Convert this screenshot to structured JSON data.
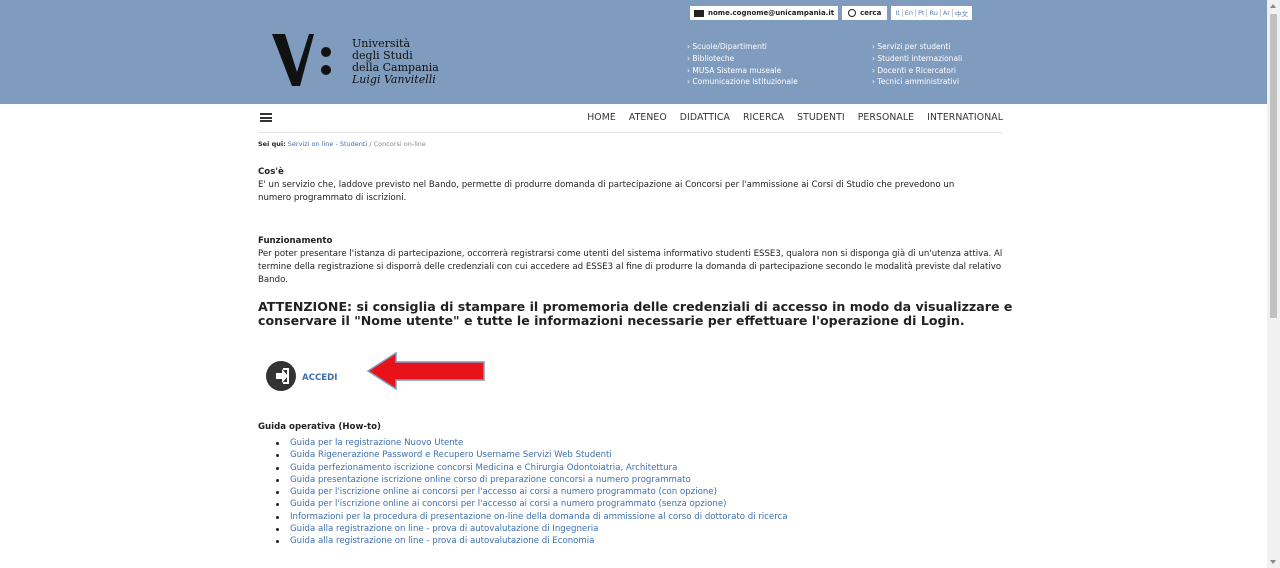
{
  "header": {
    "logo": {
      "line1": "Università",
      "line2": "degli Studi",
      "line3": "della Campania",
      "line4": "Luigi Vanvitelli"
    },
    "email": "nome.cognome@unicampania.it",
    "search_label": "cerca",
    "languages": [
      "It",
      "En",
      "Pt",
      "Ru",
      "Ar",
      "中文"
    ],
    "links_col1": [
      "Scuole/Dipartimenti",
      "Biblioteche",
      "MUSA Sistema museale",
      "Comunicazione Istituzionale"
    ],
    "links_col2": [
      "Servizi per studenti",
      "Studenti internazionali",
      "Docenti e Ricercatori",
      "Tecnici amministrativi"
    ]
  },
  "nav": {
    "items": [
      "HOME",
      "ATENEO",
      "DIDATTICA",
      "RICERCA",
      "STUDENTI",
      "PERSONALE",
      "INTERNATIONAL"
    ]
  },
  "breadcrumb": {
    "prefix": "Sei qui:",
    "link": "Servizi on line - Studenti",
    "separator": "/",
    "current": "Concorsi on-line"
  },
  "content": {
    "cose_title": "Cos'è",
    "cose_text": "E' un servizio che, laddove previsto nel Bando, permette di produrre domanda di partecipazione ai Concorsi per l'ammissione ai Corsi di Studio che prevedono un numero programmato di iscrizioni.",
    "funz_title": "Funzionamento",
    "funz_text": "Per poter presentare l'istanza di partecipazione, occorrerà registrarsi come utenti del sistema informativo studenti ESSE3, qualora non si disponga già di un'utenza attiva. Al termine della registrazione si disporrà delle credenziali con cui accedere ad ESSE3 al fine di produrre la domanda di partecipazione secondo le modalità previste dal relativo Bando.",
    "attention": "ATTENZIONE: si consiglia di stampare il promemoria delle credenziali di accesso in modo da visualizzare e conservare il \"Nome utente\" e tutte le informazioni necessarie per effettuare l'operazione di Login.",
    "accedi_label": "ACCEDI",
    "guida_title": "Guida operativa (How-to)",
    "guide": [
      "Guida per la registrazione Nuovo Utente",
      "Guida Rigenerazione Password e Recupero Username Servizi Web Studenti",
      "Guida perfezionamento iscrizione concorsi Medicina e Chirurgia Odontoiatria, Architettura",
      "Guida presentazione iscrizione online corso di preparazione concorsi a numero programmato",
      "Guida per l'iscrizione online ai concorsi per l'accesso ai corsi a numero programmato (con opzione)",
      "Guida per l'iscrizione online ai concorsi per l'accesso ai corsi a numero programmato (senza opzione)",
      "Informazioni per la procedura di presentazione on-line della domanda di ammissione al corso di dottorato di ricerca",
      "Guida alla registrazione on line - prova di autovalutazione di Ingegneria",
      "Guida alla registrazione on line - prova di autovalutazione di Economia"
    ]
  },
  "colors": {
    "header_bg": "#7f9bbd",
    "link": "#3d6fb0",
    "arrow_red": "#e8131a"
  }
}
